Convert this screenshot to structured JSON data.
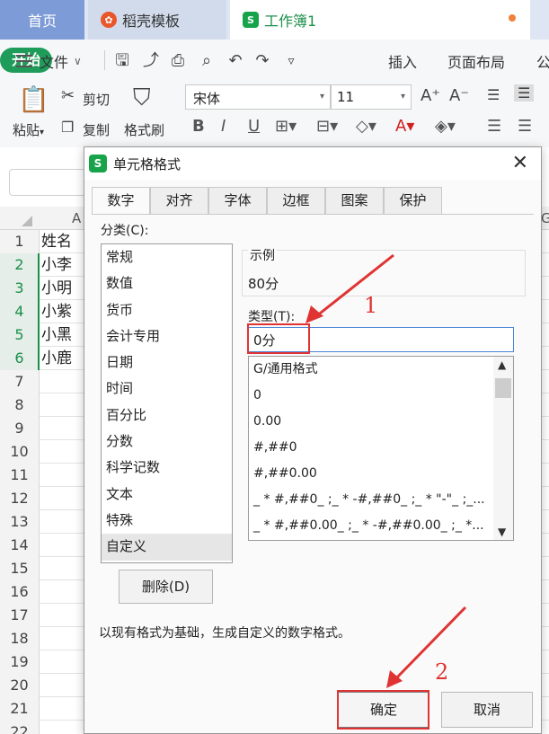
{
  "tabs": {
    "home": "首页",
    "template": "稻壳模板",
    "workbook": "工作簿1"
  },
  "menu": {
    "file": "文件",
    "start": "开始",
    "insert": "插入",
    "page_layout": "页面布局",
    "more": "公"
  },
  "ribbon": {
    "paste": "粘贴",
    "cut": "剪切",
    "copy": "复制",
    "format_painter": "格式刷",
    "font_name": "宋体",
    "font_size": "11"
  },
  "sheet": {
    "col_a": "A",
    "col_g": "G",
    "rows": [
      {
        "num": "1",
        "a": "姓名"
      },
      {
        "num": "2",
        "a": "小李"
      },
      {
        "num": "3",
        "a": "小明"
      },
      {
        "num": "4",
        "a": "小紫"
      },
      {
        "num": "5",
        "a": "小黑"
      },
      {
        "num": "6",
        "a": "小鹿"
      },
      {
        "num": "7",
        "a": ""
      },
      {
        "num": "8",
        "a": ""
      },
      {
        "num": "9",
        "a": ""
      },
      {
        "num": "10",
        "a": ""
      },
      {
        "num": "11",
        "a": ""
      },
      {
        "num": "12",
        "a": ""
      },
      {
        "num": "13",
        "a": ""
      },
      {
        "num": "14",
        "a": ""
      },
      {
        "num": "15",
        "a": ""
      },
      {
        "num": "16",
        "a": ""
      },
      {
        "num": "17",
        "a": ""
      },
      {
        "num": "18",
        "a": ""
      },
      {
        "num": "19",
        "a": ""
      },
      {
        "num": "20",
        "a": ""
      },
      {
        "num": "21",
        "a": ""
      },
      {
        "num": "22",
        "a": ""
      }
    ]
  },
  "dialog": {
    "title": "单元格格式",
    "tabs": [
      "数字",
      "对齐",
      "字体",
      "边框",
      "图案",
      "保护"
    ],
    "category_label": "分类(C):",
    "categories": [
      "常规",
      "数值",
      "货币",
      "会计专用",
      "日期",
      "时间",
      "百分比",
      "分数",
      "科学记数",
      "文本",
      "特殊",
      "自定义"
    ],
    "selected_category": "自定义",
    "sample_label": "示例",
    "sample_value": "80分",
    "type_label": "类型(T):",
    "type_value": "0分",
    "type_options": [
      "G/通用格式",
      "0",
      "0.00",
      "#,##0",
      "#,##0.00",
      "_ * #,##0_ ;_ * -#,##0_ ;_ * \"-\"_ ;_...",
      "_ * #,##0.00_ ;_ * -#,##0.00_ ;_ *..."
    ],
    "delete_button": "删除(D)",
    "description": "以现有格式为基础，生成自定义的数字格式。",
    "ok_button": "确定",
    "cancel_button": "取消"
  },
  "annotations": {
    "step1": "1",
    "step2": "2",
    "color": "#e03434"
  },
  "colors": {
    "accent_green": "#1f9c5a",
    "tab_home_bg": "#7d9bd6"
  }
}
